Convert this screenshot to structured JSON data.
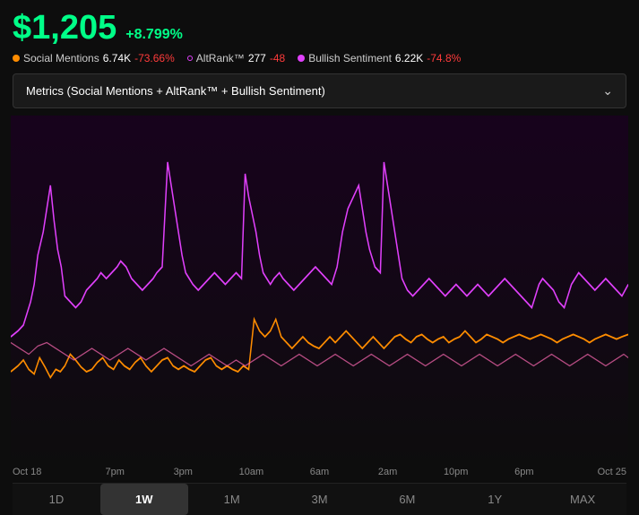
{
  "header": {
    "price": "$1,205",
    "price_change": "+8.799%"
  },
  "metrics": [
    {
      "label": "Social Mentions",
      "value": "6.74K",
      "change": "-73.66%",
      "dot_color": "orange",
      "change_type": "neg"
    },
    {
      "label": "AltRank™",
      "value": "277",
      "change": "-48",
      "dot_color": "none",
      "change_type": "neg"
    },
    {
      "label": "Bullish Sentiment",
      "value": "6.22K",
      "change": "-74.8%",
      "dot_color": "pink",
      "change_type": "neg"
    }
  ],
  "dropdown": {
    "label": "Metrics (Social Mentions + AltRank™ + Bullish Sentiment)"
  },
  "chart": {
    "time_labels": [
      "Oct 18",
      "7pm",
      "3pm",
      "10am",
      "6am",
      "2am",
      "10pm",
      "6pm",
      "Oct 25"
    ]
  },
  "periods": [
    {
      "label": "1D",
      "active": false
    },
    {
      "label": "1W",
      "active": true
    },
    {
      "label": "1M",
      "active": false
    },
    {
      "label": "3M",
      "active": false
    },
    {
      "label": "6M",
      "active": false
    },
    {
      "label": "1Y",
      "active": false
    },
    {
      "label": "MAX",
      "active": false
    }
  ]
}
